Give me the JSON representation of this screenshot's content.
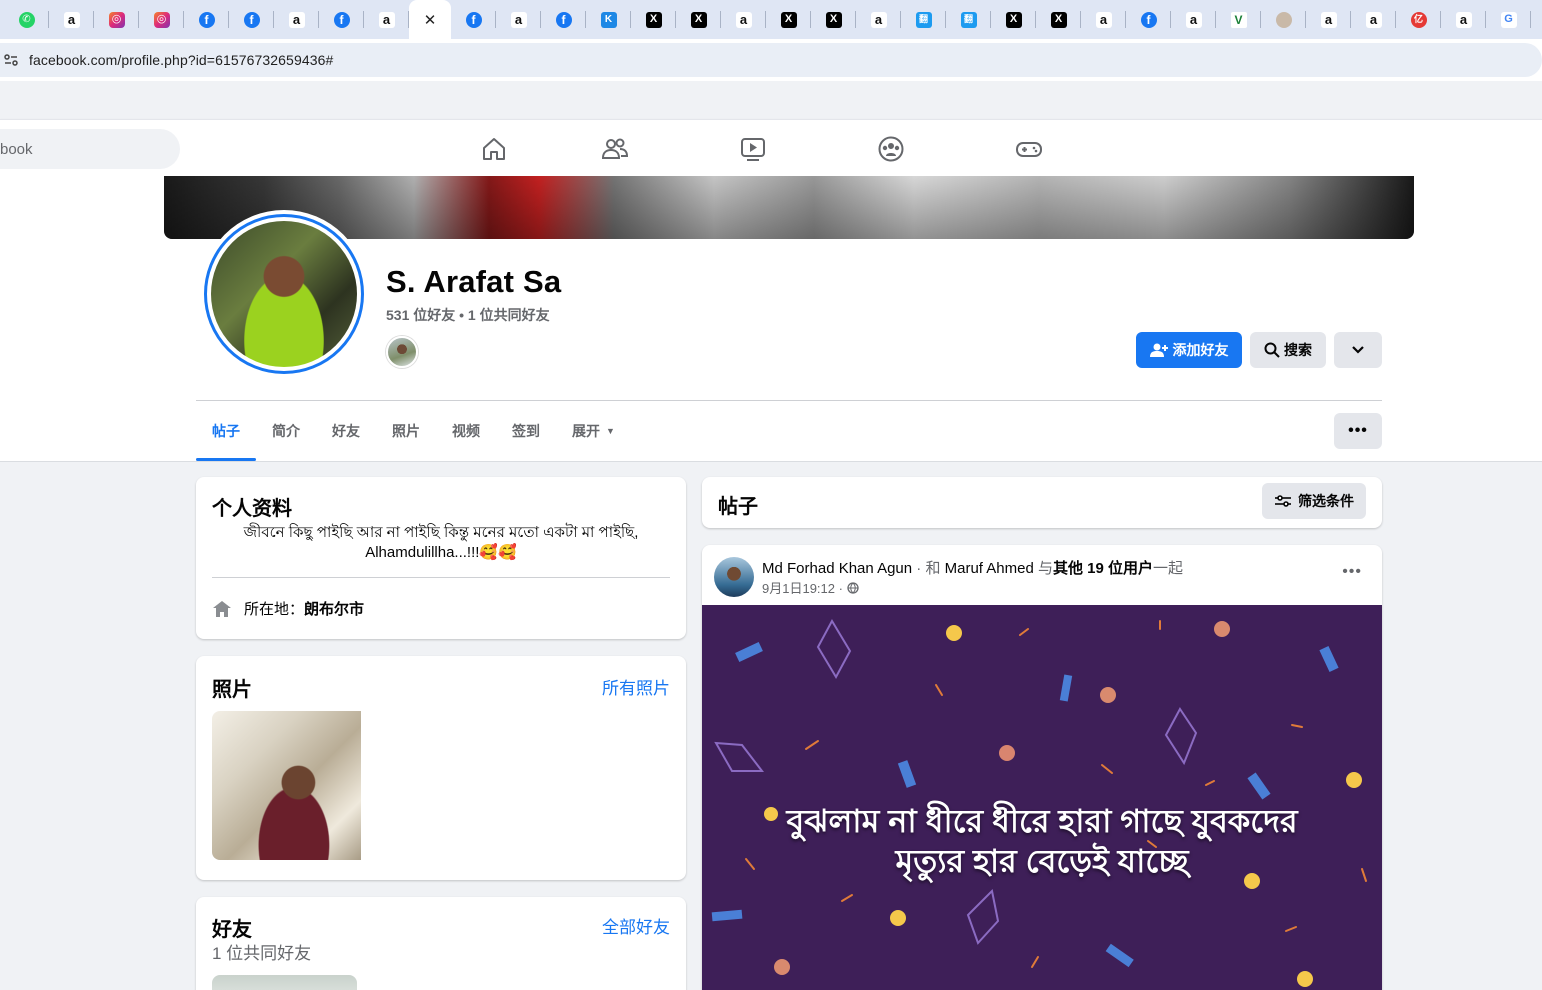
{
  "browser": {
    "tabs": [
      {
        "icon": "whatsapp-icon",
        "kind": "wa"
      },
      {
        "icon": "amazon-icon",
        "kind": "amz"
      },
      {
        "icon": "instagram-icon",
        "kind": "ig"
      },
      {
        "icon": "instagram-icon",
        "kind": "ig"
      },
      {
        "icon": "facebook-icon",
        "kind": "fb"
      },
      {
        "icon": "facebook-icon",
        "kind": "fb"
      },
      {
        "icon": "amazon-icon",
        "kind": "amz"
      },
      {
        "icon": "facebook-icon",
        "kind": "fb"
      },
      {
        "icon": "amazon-icon",
        "kind": "amz"
      },
      {
        "icon": "close-icon",
        "kind": "active"
      },
      {
        "icon": "facebook-icon",
        "kind": "fb"
      },
      {
        "icon": "amazon-icon",
        "kind": "amz"
      },
      {
        "icon": "facebook-icon",
        "kind": "fb"
      },
      {
        "icon": "kk-icon",
        "kind": "kk"
      },
      {
        "icon": "x-icon",
        "kind": "x"
      },
      {
        "icon": "x-icon",
        "kind": "x"
      },
      {
        "icon": "amazon-icon",
        "kind": "amz"
      },
      {
        "icon": "x-icon",
        "kind": "x"
      },
      {
        "icon": "x-icon",
        "kind": "x"
      },
      {
        "icon": "amazon-icon",
        "kind": "amz"
      },
      {
        "icon": "translate-icon",
        "kind": "blue"
      },
      {
        "icon": "translate-icon",
        "kind": "blue"
      },
      {
        "icon": "x-icon",
        "kind": "x"
      },
      {
        "icon": "x-icon",
        "kind": "x"
      },
      {
        "icon": "amazon-icon",
        "kind": "amz"
      },
      {
        "icon": "facebook-icon",
        "kind": "fb"
      },
      {
        "icon": "amazon-icon",
        "kind": "amz"
      },
      {
        "icon": "vue-icon",
        "kind": "v"
      },
      {
        "icon": "profile-picture-icon",
        "kind": "pic"
      },
      {
        "icon": "amazon-icon",
        "kind": "amz"
      },
      {
        "icon": "amazon-icon",
        "kind": "amz"
      },
      {
        "icon": "yi-icon",
        "kind": "red"
      },
      {
        "icon": "amazon-icon",
        "kind": "amz"
      },
      {
        "icon": "google-translate-icon",
        "kind": "tr"
      }
    ],
    "url": "facebook.com/profile.php?id=61576732659436#"
  },
  "fbnav": {
    "search_text": "book",
    "icons": [
      "home-icon",
      "friends-icon",
      "video-icon",
      "groups-icon",
      "gaming-icon"
    ]
  },
  "profile": {
    "name": "S. Arafat Sa",
    "friends_line": "531 位好友 • 1 位共同好友",
    "add_friend": "添加好友",
    "search": "搜索",
    "tabs": [
      "帖子",
      "简介",
      "好友",
      "照片",
      "视频",
      "签到",
      "展开"
    ]
  },
  "intro": {
    "title": "个人资料",
    "bio": "জীবনে কিছু পাইছি আর না পাইছি কিন্তু মনের মতো একটা মা পাইছি, Alhamdulillha...!!!🥰🥰",
    "lives_label": "所在地：",
    "lives_value": "朗布尔市"
  },
  "photos": {
    "title": "照片",
    "link": "所有照片"
  },
  "friends": {
    "title": "好友",
    "subtitle": "1 位共同好友",
    "link": "全部好友"
  },
  "posts": {
    "title": "帖子",
    "filter": "筛选条件",
    "post": {
      "author": "Md Forhad Khan Agun",
      "sep1": " · 和 ",
      "tagged": "Maruf Ahmed",
      "sep2": " 与",
      "others": "其他 19 位用户",
      "sep3": "一起",
      "time": "9月1日19:12 ·",
      "text_line1": "বুঝলাম না ধীরে ধীরে হারা গাছে যুবকদের",
      "text_line2": "মৃত্যুর হার বেড়েই যাচ্ছে",
      "background_color": "#3e1f58"
    }
  },
  "colors": {
    "accent": "#1877f2",
    "page_bg": "#f0f2f5"
  }
}
